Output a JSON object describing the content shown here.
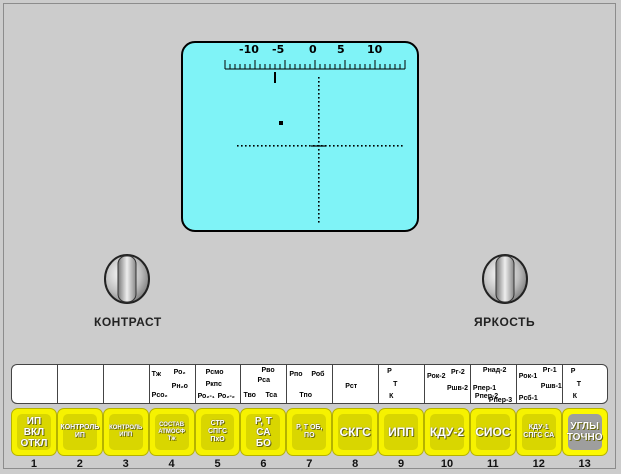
{
  "screen": {
    "scale_labels": [
      "-10",
      "-5",
      "0",
      "5",
      "10"
    ]
  },
  "knobs": {
    "contrast_label": "КОНТРАСТ",
    "brightness_label": "ЯРКОСТЬ"
  },
  "indicators": [
    {
      "lines": []
    },
    {
      "lines": []
    },
    {
      "lines": []
    },
    {
      "lines": [
        "Тж",
        "Ро₂",
        "Рсо₂",
        "Рн₂о"
      ]
    },
    {
      "lines": [
        "Рсмо",
        "Ркпс",
        "Ро₂-₁",
        "Ро₂-₂"
      ]
    },
    {
      "lines": [
        "Рво",
        "Рса",
        "Тво",
        "Тса"
      ]
    },
    {
      "lines": [
        "Рпо",
        "Роб",
        "Тпо"
      ]
    },
    {
      "lines": [
        "Рст"
      ]
    },
    {
      "lines": [
        "Р",
        "Т",
        "К"
      ]
    },
    {
      "lines": [
        "Рок-2",
        "Рг-2",
        "Ршв-2"
      ]
    },
    {
      "lines": [
        "Рнад-2",
        "Рпер-1",
        "Рпер-2",
        "Рпер-3"
      ]
    },
    {
      "lines": [
        "Рок-1",
        "Рг-1",
        "Ршв-1",
        "Рсб-1"
      ]
    },
    {
      "lines": [
        "Р",
        "Т",
        "К"
      ]
    }
  ],
  "keys": [
    {
      "label": "ИП ВКЛ ОТКЛ"
    },
    {
      "label": "КОНТРОЛЬ ИП"
    },
    {
      "label": "КОНТРОЛЬ ИПП"
    },
    {
      "label": "СОСТАВ АТМОСФ Тж"
    },
    {
      "label": "СТР СПГС ПхО"
    },
    {
      "label": "Р, Т СА БО"
    },
    {
      "label": "Р, Т ОБ, ПО"
    },
    {
      "label": "СКГС"
    },
    {
      "label": "ИПП"
    },
    {
      "label": "КДУ-2"
    },
    {
      "label": "СИОС"
    },
    {
      "label": "КДУ-1 СПГС СА"
    },
    {
      "label": "УГЛЫ ТОЧНО"
    }
  ],
  "numbers": [
    "1",
    "2",
    "3",
    "4",
    "5",
    "6",
    "7",
    "8",
    "9",
    "10",
    "11",
    "12",
    "13"
  ]
}
